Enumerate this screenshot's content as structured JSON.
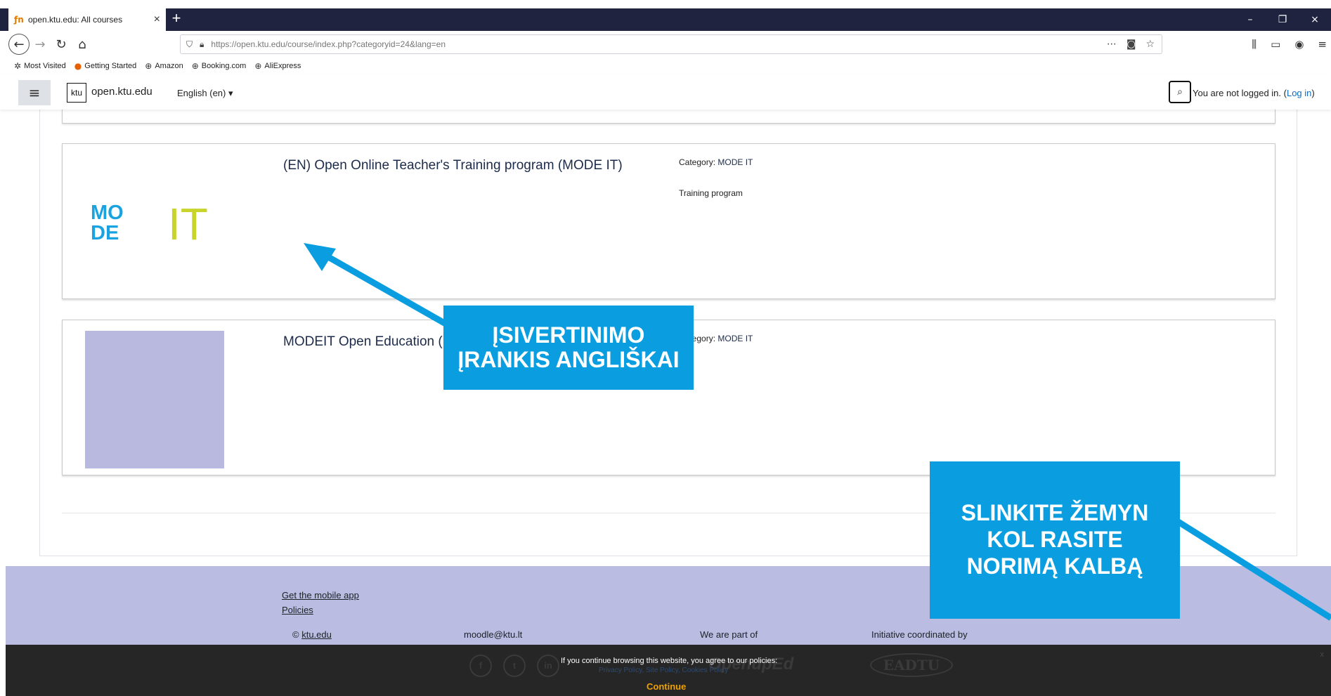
{
  "browser": {
    "tab_title": "open.ktu.edu: All courses",
    "tab_favicon": "ƒn",
    "new_tab": "+",
    "url": "https://open.ktu.edu/course/index.php?categoryid=24&lang=en",
    "bookmarks": [
      "Most Visited",
      "Getting Started",
      "Amazon",
      "Booking.com",
      "AliExpress"
    ]
  },
  "header": {
    "logo_text": "ktu",
    "site_name": "open.ktu.edu",
    "language": "English (en)",
    "login_prefix": "You are not logged in. (",
    "login_link": "Log in",
    "login_suffix": ")"
  },
  "courses": [
    {
      "title": "(EN) Open Online Teacher's Training program (MODE IT)",
      "category_label": "Category: ",
      "category": "MODE IT",
      "summary": "Training program",
      "logo_text_1": "MO",
      "logo_text_2": "DE",
      "logo_text_3": "IT"
    },
    {
      "title": "MODEIT Open Education (",
      "category_label": "Category: ",
      "category": "MODE IT"
    }
  ],
  "annotations": {
    "first": [
      "ĮSIVERTINIMO",
      "ĮRANKIS ANGLIŠKAI"
    ],
    "second": [
      "SLINKITE ŽEMYN",
      "KOL RASITE",
      "NORIMĄ KALBĄ"
    ]
  },
  "footer": {
    "mobile_app": "Get the mobile app",
    "policies": "Policies",
    "copyright_prefix": "© ",
    "copyright_link": "ktu.edu",
    "email": "moodle@ktu.lt",
    "part_of": "We are part of",
    "coordinated_by": "Initiative coordinated by",
    "openuped": "OpenupEd",
    "eadtu": "EADTU"
  },
  "cookie": {
    "message": "If you continue browsing this website, you agree to our policies:",
    "links": "Privacy Policy, Site Policy, Cookies Policy",
    "continue": "Continue",
    "close": "x"
  },
  "colors": {
    "browser_dark": "#202340",
    "annotation_blue": "#0a9ee0",
    "footer_lavender": "#babce2",
    "cookie_bar": "#262626",
    "continue_orange": "#f0a000",
    "mode_blue": "#1aa3e0",
    "mode_green": "#c8d42a"
  }
}
